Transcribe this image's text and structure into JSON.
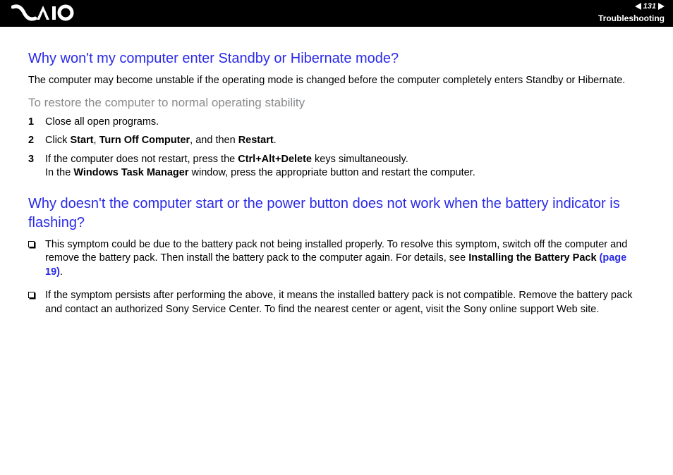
{
  "header": {
    "page_number": "131",
    "section": "Troubleshooting"
  },
  "q1": {
    "heading": "Why won't my computer enter Standby or Hibernate mode?",
    "intro": "The computer may become unstable if the operating mode is changed before the computer completely enters Standby or Hibernate.",
    "subhead": "To restore the computer to normal operating stability",
    "steps": {
      "n1": "1",
      "t1": "Close all open programs.",
      "n2": "2",
      "t2_a": "Click ",
      "t2_b1": "Start",
      "t2_c": ", ",
      "t2_b2": "Turn Off Computer",
      "t2_d": ", and then ",
      "t2_b3": "Restart",
      "t2_e": ".",
      "n3": "3",
      "t3_a": "If the computer does not restart, press the ",
      "t3_b1": "Ctrl+Alt+Delete",
      "t3_c": " keys simultaneously.",
      "t3_line2_a": "In the ",
      "t3_line2_b": "Windows Task Manager",
      "t3_line2_c": " window, press the appropriate button and restart the computer."
    }
  },
  "q2": {
    "heading": "Why doesn't the computer start or the power button does not work when the battery indicator is flashing?",
    "b1_a": "This symptom could be due to the battery pack not being installed properly. To resolve this symptom, switch off the computer and remove the battery pack. Then install the battery pack to the computer again. For details, see ",
    "b1_bold": "Installing the Battery Pack",
    "b1_sp": " ",
    "b1_link": "(page 19)",
    "b1_end": ".",
    "b2": "If the symptom persists after performing the above, it means the installed battery pack is not compatible. Remove the battery pack and contact an authorized Sony Service Center. To find the nearest center or agent, visit the Sony online support Web site."
  }
}
